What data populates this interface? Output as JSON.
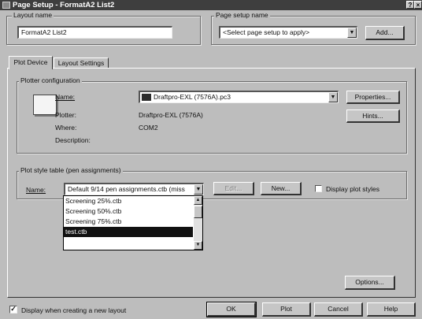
{
  "window": {
    "title": "Page Setup - FormatA2 List2",
    "help_glyph": "?",
    "close_glyph": "×"
  },
  "layout_name": {
    "label": "Layout name",
    "value": "FormatA2 List2"
  },
  "page_setup_name": {
    "label": "Page setup name",
    "value": "<Select page setup to apply>",
    "add_button": "Add..."
  },
  "tabs": [
    {
      "label": "Plot Device",
      "active": true
    },
    {
      "label": "Layout Settings",
      "active": false
    }
  ],
  "plotter_configuration": {
    "caption": "Plotter configuration",
    "name_label": "Name:",
    "name_value": "Draftpro-EXL (7576A).pc3",
    "plotter_label": "Plotter:",
    "plotter_value": "Draftpro-EXL (7576A)",
    "where_label": "Where:",
    "where_value": "COM2",
    "description_label": "Description:",
    "description_value": "",
    "properties_button": "Properties...",
    "hints_button": "Hints...",
    "icon": "plotter-icon"
  },
  "plot_style_table": {
    "caption": "Plot style table (pen assignments)",
    "name_label": "Name:",
    "name_value": "Default 9/14 pen assignments.ctb (miss",
    "edit_button": "Edit...",
    "new_button": "New...",
    "display_plot_styles_label": "Display plot styles",
    "display_plot_styles_checked": false,
    "dropdown_items": [
      {
        "label": "Screening 25%.ctb",
        "selected": false
      },
      {
        "label": "Screening 50%.ctb",
        "selected": false
      },
      {
        "label": "Screening 75%.ctb",
        "selected": false
      },
      {
        "label": "test.ctb",
        "selected": true
      },
      {
        "label": "",
        "selected": false
      }
    ]
  },
  "options_button": "Options...",
  "footer": {
    "display_when_creating_label": "Display when creating a new layout",
    "display_when_creating_checked": true,
    "check_glyph": "✓",
    "ok_button": "OK",
    "plot_button": "Plot",
    "cancel_button": "Cancel",
    "help_button": "Help"
  },
  "glyphs": {
    "dropdown_arrow": "▼",
    "scroll_up": "▲",
    "scroll_down": "▼"
  }
}
